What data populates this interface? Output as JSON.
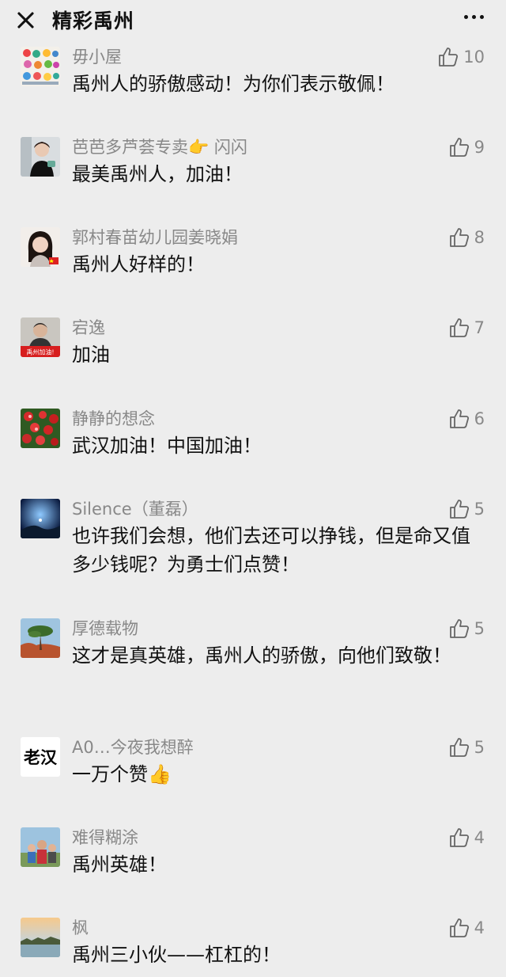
{
  "header": {
    "title": "精彩禹州"
  },
  "comments": [
    {
      "name": "毋小屋",
      "text": "禹州人的骄傲感动！为你们表示敬佩！",
      "likes": "10"
    },
    {
      "name": "芭芭多芦荟专卖👉 闪闪",
      "text": "最美禹州人，加油！",
      "likes": "9"
    },
    {
      "name": "郭村春苗幼儿园姜晓娟",
      "text": "禹州人好样的！",
      "likes": "8"
    },
    {
      "name": "宕逸",
      "text": "加油",
      "likes": "7",
      "avatar_text": "禹州加油!"
    },
    {
      "name": "静静的想念",
      "text": "武汉加油！中国加油！",
      "likes": "6"
    },
    {
      "name": "Silence（董磊）",
      "text": "也许我们会想，他们去还可以挣钱，但是命又值多少钱呢？为勇士们点赞！",
      "likes": "5"
    },
    {
      "name": "厚德载物",
      "text": "这才是真英雄，禹州人的骄傲，向他们致敬！",
      "likes": "5"
    },
    {
      "name": "A0…今夜我想醉",
      "text": "一万个赞👍",
      "likes": "5",
      "avatar_text": "老汉"
    },
    {
      "name": "难得糊涂",
      "text": "禹州英雄！",
      "likes": "4"
    },
    {
      "name": "枫",
      "text": "禹州三小伙——杠杠的！",
      "likes": "4"
    }
  ],
  "colors": {
    "background": "#ededed",
    "name": "#888888",
    "text": "#111111"
  },
  "icons": {
    "close": "close-icon",
    "more": "more-icon",
    "like": "thumbs-up-icon"
  }
}
